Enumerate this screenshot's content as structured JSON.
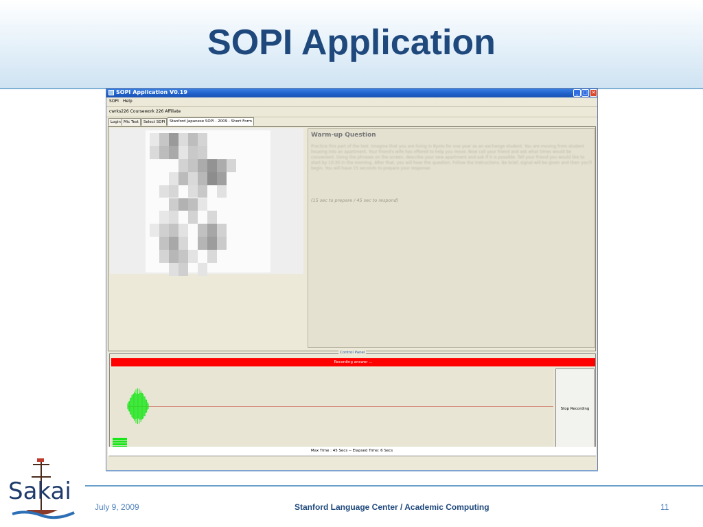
{
  "slide": {
    "title": "SOPI Application",
    "footer_date": "July 9, 2009",
    "footer_center": "Stanford Language Center / Academic Computing",
    "page_number": "11",
    "logo_text": "Sakai"
  },
  "window": {
    "title": "SOPI Application V0.19",
    "menu": [
      "SOPI",
      "Help"
    ],
    "user_info": "cwrks226  Coursework 226  Affiliate",
    "tabs": [
      "Login",
      "Mic Test",
      "Select SOPI",
      "Stanford Japanese SOPI - 2009 - Short Form"
    ],
    "active_tab": "Stanford Japanese SOPI - 2009 - Short Form"
  },
  "question": {
    "title": "Warm-up Question",
    "body": "Practice this part of the test. Imagine that you are living in Kyoto for one year as an exchange student. You are moving from student housing into an apartment. Your friend's wife has offered to help you move. Now call your friend and ask what times would be convenient. Using the phrases on the screen, describe your new apartment and ask if it is possible. Tell your friend you would like to start by 10:30 in the morning. After that, you will hear the question. Follow the instructions. Be brief, signal will be given and then you'll begin. You will have 15 seconds to prepare your response.",
    "timing": "(15 sec to prepare / 45 sec to respond)"
  },
  "control_panel": {
    "label": "Control Panel",
    "recording_status": "Recording answer ...",
    "stop_button": "Stop Recording",
    "timing_status": "Max Time : 45 Secs  --  Elapsed Time: 6 Secs"
  },
  "colors": {
    "title_blue": "#1f497d",
    "recording_red": "#ff0000",
    "waveform_green": "#19e619",
    "titlebar_blue": "#1f5fc8"
  }
}
